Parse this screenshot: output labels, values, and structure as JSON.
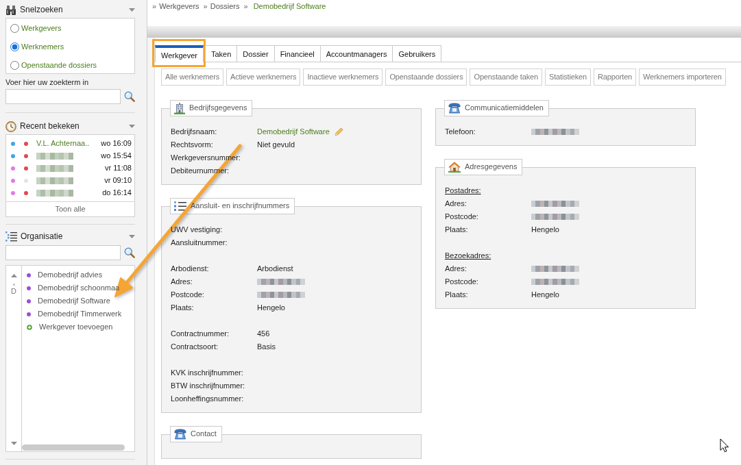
{
  "sidebar": {
    "quick_search": {
      "title": "Snelzoeken",
      "options": [
        {
          "label": "Werkgevers",
          "selected": false
        },
        {
          "label": "Werknemers",
          "selected": true
        },
        {
          "label": "Openstaande dossiers",
          "selected": false
        }
      ],
      "search_label": "Voer hier uw zoekterm in"
    },
    "recent": {
      "title": "Recent bekeken",
      "items": [
        {
          "dots": [
            {
              "color": "#3fa6e3"
            },
            {
              "color": "#e5484d"
            }
          ],
          "redacted": false,
          "name": "V.L. Achternaa..",
          "time": "wo 16:09"
        },
        {
          "dots": [
            {
              "color": "#3fa6e3"
            },
            {
              "color": "#e5484d"
            }
          ],
          "redacted": true,
          "time": "wo 15:54"
        },
        {
          "dots": [
            {
              "color": "#e37ae3"
            },
            {
              "color": "#e5484d"
            }
          ],
          "redacted": true,
          "time": "vr 11:08"
        },
        {
          "dots": [
            {
              "color": "#e37ae3"
            },
            {
              "color": "#e4e4e4"
            }
          ],
          "redacted": true,
          "time": "vr 09:10"
        },
        {
          "dots": [
            {
              "color": "#e37ae3"
            },
            {
              "color": "#e5484d"
            }
          ],
          "redacted": true,
          "time": "do 16:14"
        }
      ],
      "show_all": "Toon alle"
    },
    "organisation": {
      "title": "Organisatie",
      "index_letter": "D",
      "items": [
        {
          "kind": "employer",
          "label": "Demobedrijf advies"
        },
        {
          "kind": "employer",
          "label": "Demobedrijf schoonmaa"
        },
        {
          "kind": "employer",
          "label": "Demobedrijf Software"
        },
        {
          "kind": "employer",
          "label": "Demobedrijf Timmerwerk"
        },
        {
          "kind": "add",
          "label": "Werkgever toevoegen"
        }
      ]
    }
  },
  "breadcrumb": [
    {
      "separator": "»",
      "label": "Werkgevers",
      "current": false
    },
    {
      "separator": "»",
      "label": "Dossiers",
      "current": false
    },
    {
      "separator": "»",
      "label": "Demobedrijf Software",
      "current": true
    }
  ],
  "tabs": [
    {
      "label": "Werkgever",
      "selected": true,
      "highlighted": true
    },
    {
      "label": "Taken",
      "selected": false,
      "highlighted": false
    },
    {
      "label": "Dossier",
      "selected": false,
      "highlighted": false
    },
    {
      "label": "Financieel",
      "selected": false,
      "highlighted": false
    },
    {
      "label": "Accountmanagers",
      "selected": false,
      "highlighted": false
    },
    {
      "label": "Gebruikers",
      "selected": false,
      "highlighted": false
    }
  ],
  "subtabs": [
    "Alle werknemers",
    "Actieve werknemers",
    "Inactieve werknemers",
    "Openstaande dossiers",
    "Openstaande taken",
    "Statistieken",
    "Rapporten",
    "Werknemers importeren"
  ],
  "panel_columns": [
    {
      "panels": [
        {
          "kind": "building",
          "title": "Bedrijfsgegevens",
          "groups": [
            {
              "rows": [
                {
                  "label": "Bedrijfsnaam:",
                  "kind": "link",
                  "value": "Demobedrijf Software",
                  "editable": true
                },
                {
                  "label": "Rechtsvorm:",
                  "kind": "text",
                  "value": "Niet gevuld"
                },
                {
                  "label": "Werkgeversnummer:",
                  "kind": "blank"
                },
                {
                  "label": "Debiteurnummer:",
                  "kind": "blank"
                }
              ]
            }
          ]
        },
        {
          "kind": "list",
          "title": "Aansluit- en inschrijfnummers",
          "groups": [
            {
              "rows": [
                {
                  "label": "UWV vestiging:",
                  "kind": "blank"
                },
                {
                  "label": "Aansluitnummer:",
                  "kind": "blank"
                }
              ]
            },
            {
              "rows": [
                {
                  "label": "Arbodienst:",
                  "kind": "text",
                  "value": "Arbodienst"
                },
                {
                  "label": "Adres:",
                  "kind": "redacted"
                },
                {
                  "label": "Postcode:",
                  "kind": "redacted"
                },
                {
                  "label": "Plaats:",
                  "kind": "text",
                  "value": "Hengelo"
                }
              ]
            },
            {
              "rows": [
                {
                  "label": "Contractnummer:",
                  "kind": "text",
                  "value": "456"
                },
                {
                  "label": "Contractsoort:",
                  "kind": "text",
                  "value": "Basis"
                }
              ]
            },
            {
              "rows": [
                {
                  "label": "KVK inschrijfnummer:",
                  "kind": "blank"
                },
                {
                  "label": "BTW inschrijfnummer:",
                  "kind": "blank"
                },
                {
                  "label": "Loonheffingsnummer:",
                  "kind": "blank"
                }
              ]
            }
          ]
        },
        {
          "kind": "phone",
          "title": "Contact"
        }
      ]
    },
    {
      "panels": [
        {
          "kind": "phone",
          "title": "Communicatiemiddelen",
          "groups": [
            {
              "rows": [
                {
                  "label": "Telefoon:",
                  "kind": "redacted"
                }
              ]
            }
          ]
        },
        {
          "kind": "house",
          "title": "Adresgegevens",
          "groups": [
            {
              "heading": "Postadres:",
              "rows": [
                {
                  "label": "Adres:",
                  "kind": "redacted"
                },
                {
                  "label": "Postcode:",
                  "kind": "redacted"
                },
                {
                  "label": "Plaats:",
                  "kind": "text",
                  "value": "Hengelo"
                }
              ]
            },
            {
              "heading": "Bezoekadres:",
              "rows": [
                {
                  "label": "Adres:",
                  "kind": "redacted"
                },
                {
                  "label": "Postcode:",
                  "kind": "redacted"
                },
                {
                  "label": "Plaats:",
                  "kind": "text",
                  "value": "Hengelo"
                }
              ]
            }
          ]
        }
      ]
    }
  ]
}
